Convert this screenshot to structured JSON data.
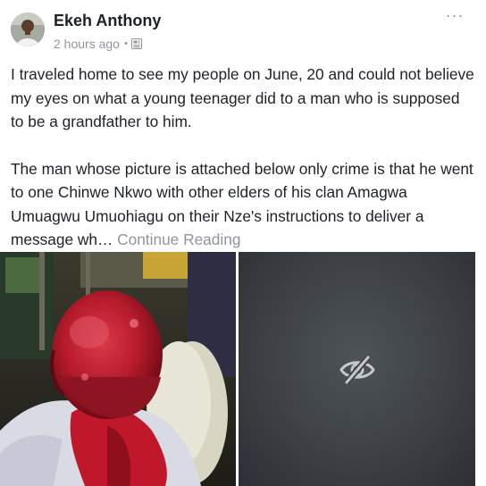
{
  "post": {
    "author": "Ekeh Anthony",
    "timestamp": "2 hours ago",
    "separator": "•",
    "more_label": "···",
    "paragraph_1": "I traveled home to see my people on June, 20 and could not believe my eyes on what a young teenager did to a man who is supposed to be a grandfather to him.",
    "paragraph_2": "The man whose picture is attached below only crime is that he went to one Chinwe Nkwo with other elders of his clan Amagwa Umuagwu Umuohiagu on their Nze's instructions to deliver a message wh… ",
    "continue_label": "Continue Reading"
  },
  "icons": {
    "privacy": "public-globe-icon",
    "more": "more-options-icon",
    "hidden_photo": "eye-slash-icon"
  },
  "colors": {
    "text": "#1d2129",
    "secondary": "#90949c",
    "hidden_photo_bg": "#3d4146"
  }
}
